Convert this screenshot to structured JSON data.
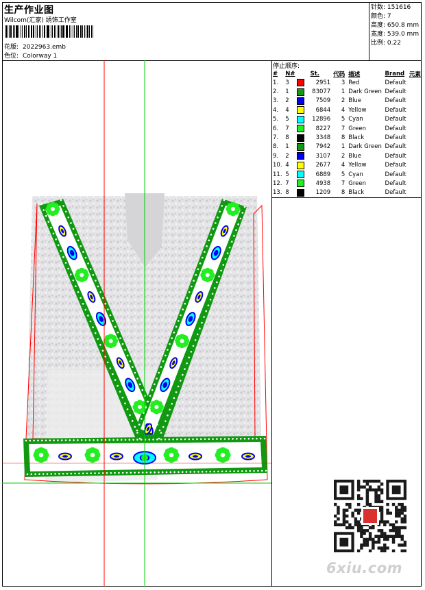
{
  "header": {
    "title": "生产作业图",
    "studio": "Wilcom(汇家) 绣饰工作室",
    "pattern_label": "花版:",
    "pattern_value": "2022963.emb",
    "colorway_label": "色位:",
    "colorway_value": "Colorway 1"
  },
  "stats": [
    {
      "label": "针数:",
      "value": "151616"
    },
    {
      "label": "颜色:",
      "value": "7"
    },
    {
      "label": "高度:",
      "value": "650.8 mm"
    },
    {
      "label": "宽度:",
      "value": "539.0 mm"
    },
    {
      "label": "比例:",
      "value": "0.22"
    }
  ],
  "stop_table": {
    "heading": "停止顺序:",
    "columns": [
      "#",
      "N#",
      "St.",
      "代码",
      "描述",
      "Brand",
      "元素"
    ],
    "rows": [
      {
        "no": "1.",
        "n": "3",
        "color": "#ff0000",
        "st": "2951",
        "code": "3",
        "desc": "Red",
        "brand": "Default"
      },
      {
        "no": "2.",
        "n": "1",
        "color": "#119911",
        "st": "83077",
        "code": "1",
        "desc": "Dark Green",
        "brand": "Default"
      },
      {
        "no": "3.",
        "n": "2",
        "color": "#0000ee",
        "st": "7509",
        "code": "2",
        "desc": "Blue",
        "brand": "Default"
      },
      {
        "no": "4.",
        "n": "4",
        "color": "#ffff00",
        "st": "6844",
        "code": "4",
        "desc": "Yellow",
        "brand": "Default"
      },
      {
        "no": "5.",
        "n": "5",
        "color": "#00ffff",
        "st": "12896",
        "code": "5",
        "desc": "Cyan",
        "brand": "Default"
      },
      {
        "no": "6.",
        "n": "7",
        "color": "#22ee22",
        "st": "8227",
        "code": "7",
        "desc": "Green",
        "brand": "Default"
      },
      {
        "no": "7.",
        "n": "8",
        "color": "#000000",
        "st": "3348",
        "code": "8",
        "desc": "Black",
        "brand": "Default"
      },
      {
        "no": "8.",
        "n": "1",
        "color": "#119911",
        "st": "7942",
        "code": "1",
        "desc": "Dark Green",
        "brand": "Default"
      },
      {
        "no": "9.",
        "n": "2",
        "color": "#0000ee",
        "st": "3107",
        "code": "2",
        "desc": "Blue",
        "brand": "Default"
      },
      {
        "no": "10.",
        "n": "4",
        "color": "#ffff00",
        "st": "2677",
        "code": "4",
        "desc": "Yellow",
        "brand": "Default"
      },
      {
        "no": "11.",
        "n": "5",
        "color": "#00ffff",
        "st": "6889",
        "code": "5",
        "desc": "Cyan",
        "brand": "Default"
      },
      {
        "no": "12.",
        "n": "7",
        "color": "#22ee22",
        "st": "4938",
        "code": "7",
        "desc": "Green",
        "brand": "Default"
      },
      {
        "no": "13.",
        "n": "8",
        "color": "#000000",
        "st": "1209",
        "code": "8",
        "desc": "Black",
        "brand": "Default"
      }
    ]
  },
  "colors": {
    "dark_green": "#119911",
    "green": "#22ee22",
    "blue": "#0000ee",
    "yellow": "#ffff00",
    "cyan": "#00ffff",
    "red": "#ff0000",
    "guide_red": "#ff0000",
    "guide_green": "#00cc00"
  },
  "icons": [
    "qr-code-icon"
  ],
  "watermark": "6xiu.com"
}
